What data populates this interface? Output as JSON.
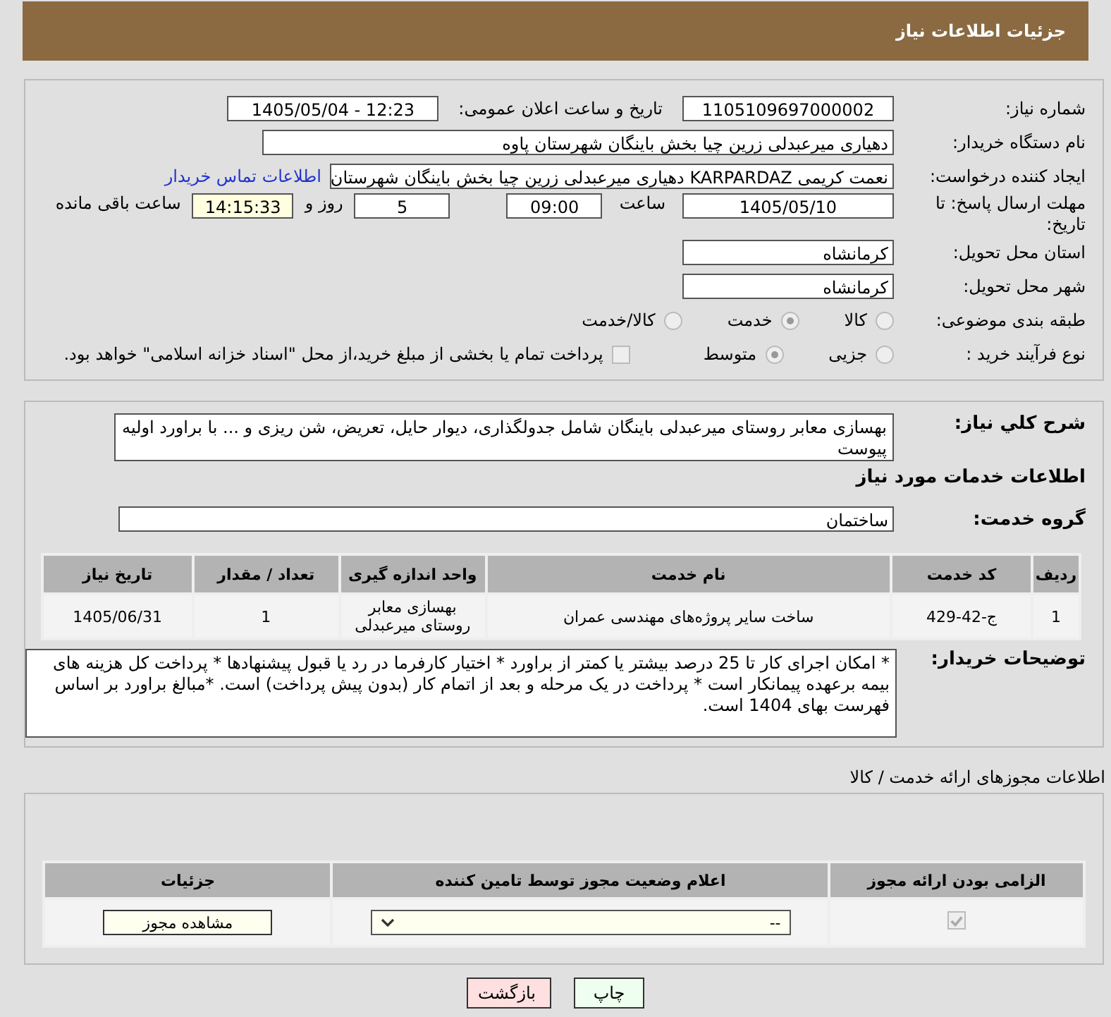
{
  "header": {
    "title": "جزئیات اطلاعات نیاز"
  },
  "summary": {
    "need_number": {
      "label": "شماره نیاز:",
      "value": "1105109697000002"
    },
    "announce": {
      "label": "تاریخ و ساعت اعلان عمومی:",
      "value": "1405/05/04 - 12:23"
    },
    "buyer": {
      "label": "نام دستگاه خریدار:",
      "value": "دهیاری میرعبدلی زرین چیا بخش باینگان شهرستان پاوه"
    },
    "requester": {
      "label": "ایجاد کننده درخواست:",
      "value": "نعمت کریمی KARPARDAZ دهیاری میرعبدلی زرین چیا بخش باینگان شهرستان",
      "link": "اطلاعات تماس خریدار"
    },
    "deadline": {
      "label": "مهلت ارسال پاسخ: تا تاریخ:",
      "date": "1405/05/10",
      "time_label": "ساعت",
      "time": "09:00",
      "days": "5",
      "days_label": "روز و",
      "remaining": "14:15:33",
      "remaining_label": "ساعت باقی مانده"
    },
    "province": {
      "label": "استان محل تحویل:",
      "value": "کرمانشاه"
    },
    "city": {
      "label": "شهر محل تحویل:",
      "value": "کرمانشاه"
    },
    "category": {
      "label": "طبقه بندی موضوعی:",
      "options": [
        {
          "label": "کالا",
          "selected": false
        },
        {
          "label": "خدمت",
          "selected": true
        },
        {
          "label": "کالا/خدمت",
          "selected": false
        }
      ]
    },
    "process": {
      "label": "نوع فرآیند خرید :",
      "options": [
        {
          "label": "جزیی",
          "selected": false
        },
        {
          "label": "متوسط",
          "selected": true
        }
      ],
      "payment": {
        "label": "پرداخت تمام یا بخشی از مبلغ خرید،از محل \"اسناد خزانه اسلامی\" خواهد بود.",
        "checked": false
      }
    }
  },
  "details": {
    "description": {
      "label": "شرح کلي نیاز:",
      "value": "بهسازی معابر روستای میرعبدلی باینگان شامل جدولگذاری، دیوار حایل، تعریض، شن ریزی و ... با براورد اولیه پیوست"
    },
    "services_title": "اطلاعات خدمات مورد نیاز",
    "service_group": {
      "label": "گروه خدمت:",
      "value": "ساختمان"
    },
    "table": {
      "columns": [
        "ردیف",
        "کد خدمت",
        "نام خدمت",
        "واحد اندازه گیری",
        "تعداد / مقدار",
        "تاریخ نیاز"
      ],
      "rows": [
        [
          "1",
          "ج-42-429",
          "ساخت سایر پروژه‌های مهندسی عمران",
          "بهسازی معابر روستای میرعبدلی",
          "1",
          "1405/06/31"
        ]
      ]
    },
    "notes": {
      "label": "توضیحات خریدار:",
      "value": "* امکان اجرای کار تا 25 درصد بیشتر یا کمتر از براورد * اختیار کارفرما در رد یا قبول پیشنهادها * پرداخت کل هزینه های بیمه برعهده پیمانکار است * پرداخت در یک مرحله و بعد از اتمام کار (بدون پیش پرداخت) است. *مبالغ براورد بر اساس فهرست بهای 1404 است."
    }
  },
  "permits": {
    "title": "اطلاعات مجوزهای ارائه خدمت / کالا",
    "columns": [
      "الزامی بودن ارائه مجوز",
      "اعلام وضعیت مجوز توسط تامین کننده",
      "جزئیات"
    ],
    "rows": [
      {
        "required": true,
        "status": "--",
        "action": "مشاهده مجوز"
      }
    ]
  },
  "buttons": [
    {
      "label": "چاپ",
      "kind": "print"
    },
    {
      "label": "بازگشت",
      "kind": "back"
    }
  ]
}
